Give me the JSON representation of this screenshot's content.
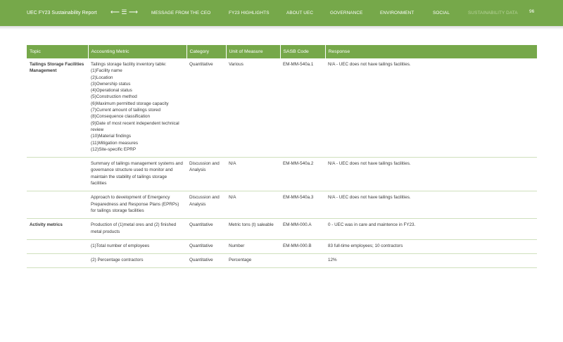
{
  "header": {
    "report_title": "UEC FY23 Sustainability Report",
    "nav_arrows": "⟵ ☰ ⟶",
    "nav_items": [
      "MESSAGE FROM THE CEO",
      "FY23 HIGHLIGHTS",
      "ABOUT UEC",
      "GOVERNANCE",
      "ENVIRONMENT",
      "SOCIAL",
      "SUSTAINABILITY DATA"
    ],
    "page_number": "96"
  },
  "table": {
    "columns": [
      "Topic",
      "Accounting Metric",
      "Category",
      "Unit of Measure",
      "SASB Code",
      "Response"
    ],
    "rows": [
      {
        "topic": "Tailings Storage Facilities Management",
        "metric_lines": [
          "Tailings storage facility inventory table:",
          "(1)Facility name",
          "(2)Location",
          "(3)Ownership status",
          "(4)Operational status",
          "(5)Construction method",
          "(6)Maximum permitted storage capacity",
          "(7)Current amount of tailings stored",
          "(8)Consequence classification",
          "(9)Date of most recent independent technical review",
          "(10)Material findings",
          "(11)Mitigation measures",
          "(12)Site-specific EPRP"
        ],
        "category": "Quantitative",
        "unit": "Various",
        "code": "EM-MM-540a.1",
        "response": "N/A - UEC does not have tailings facilities."
      },
      {
        "topic": "",
        "metric": "Summary of tailings management systems and governance structure used to monitor and maintain the stability of tailings storage facilities",
        "category": "Discussion and Analysis",
        "unit": "N/A",
        "code": "EM-MM-540a.2",
        "response": "N/A - UEC does not have tailings facilities."
      },
      {
        "topic": "",
        "metric": "Approach to development of Emergency Preparedness and Response Plans (EPRPs) for tailings storage facilities",
        "category": "Discussion and Analysis",
        "unit": "N/A",
        "code": "EM-MM-540a.3",
        "response": "N/A - UEC does not have tailings facilities."
      },
      {
        "topic": "Activity metrics",
        "metric": "Production of (1)metal ores and (2) finished metal products",
        "category": "Quantitative",
        "unit": "Metric tons (t) saleable",
        "code": "EM-MM-000.A",
        "response": "0 - UEC was in care and maintence in FY23."
      },
      {
        "topic": "",
        "metric": "(1)Total number of employees",
        "category": "Quantitative",
        "unit": "Number",
        "code": "EM-MM-000.B",
        "response": "83 full-time employees; 10 contractors"
      },
      {
        "topic": "",
        "metric": "(2) Percentage contractors",
        "category": "Quantitative",
        "unit": "Percentage",
        "code": "",
        "response": "12%"
      }
    ]
  },
  "colors": {
    "brand_green": "#76a84a",
    "row_separator": "#cfe0bd"
  }
}
